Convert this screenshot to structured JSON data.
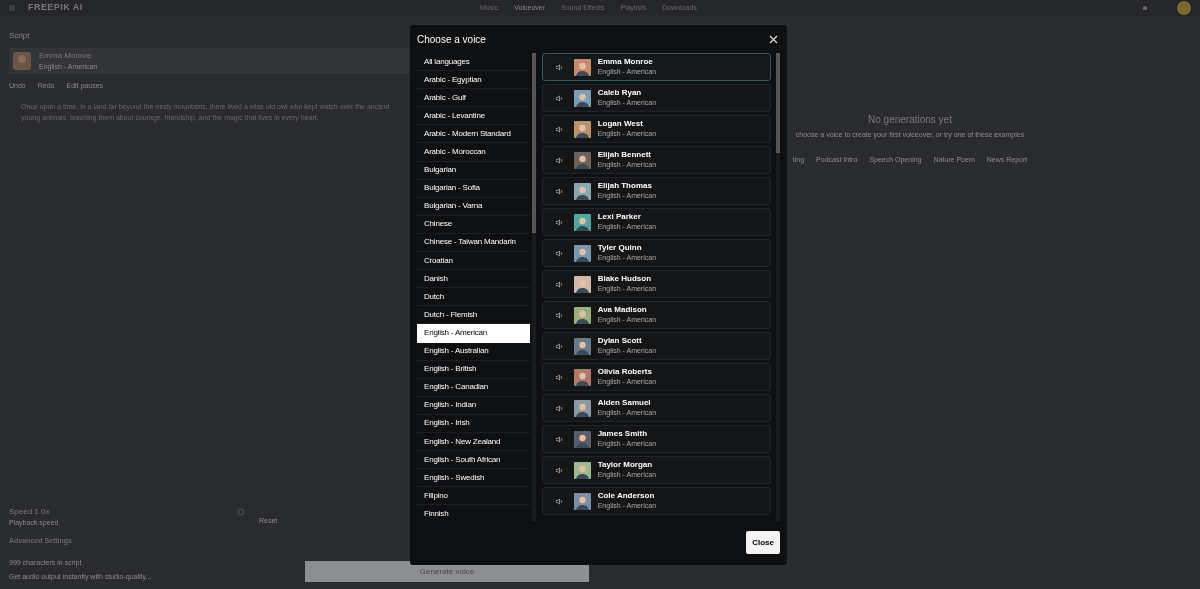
{
  "top_bar": {
    "logo": "FREEPIK AI",
    "nav": [
      {
        "label": "Music",
        "selected": false
      },
      {
        "label": "Voiceover",
        "selected": true
      },
      {
        "label": "Sound Effects",
        "selected": false
      },
      {
        "label": "Playlists",
        "selected": false
      },
      {
        "label": "Downloads",
        "selected": false
      }
    ]
  },
  "editor": {
    "heading": "Script",
    "voice": {
      "name": "Emma Monroe",
      "language": "English - American"
    },
    "tools": [
      "Undo",
      "Redo",
      "Edit pauses"
    ],
    "script_lines": [
      "Once upon a time, in a land far beyond the misty mountains, there lived a wise old owl who kept watch over the ancient",
      "young animals, teaching them about courage, friendship, and the magic that lives in every heart."
    ],
    "speed": {
      "label": "Speed 1.0x",
      "hint": "Playback speed",
      "reset": "Reset"
    },
    "advanced": "Advanced Settings",
    "notes": [
      "999 characters in script",
      "Get audio output instantly with studio-quality..."
    ],
    "generate": "Generate voice"
  },
  "results": {
    "title": "No generations yet",
    "subtitle": "choose a voice to create your first voiceover, or try one of these examples",
    "examples": [
      "ting",
      "Podcast Intro",
      "Speech Opening",
      "Nature Poem",
      "News Report"
    ]
  },
  "modal": {
    "title": "Choose a voice",
    "languages": [
      {
        "label": "All languages",
        "selected": false
      },
      {
        "label": "Arabic - Egyptian",
        "selected": false
      },
      {
        "label": "Arabic - Gulf",
        "selected": false
      },
      {
        "label": "Arabic - Levantine",
        "selected": false
      },
      {
        "label": "Arabic - Modern Standard",
        "selected": false
      },
      {
        "label": "Arabic - Moroccan",
        "selected": false
      },
      {
        "label": "Bulgarian",
        "selected": false
      },
      {
        "label": "Bulgarian - Sofia",
        "selected": false
      },
      {
        "label": "Bulgarian - Varna",
        "selected": false
      },
      {
        "label": "Chinese",
        "selected": false
      },
      {
        "label": "Chinese - Taiwan Mandarin",
        "selected": false
      },
      {
        "label": "Croatian",
        "selected": false
      },
      {
        "label": "Danish",
        "selected": false
      },
      {
        "label": "Dutch",
        "selected": false
      },
      {
        "label": "Dutch - Flemish",
        "selected": false
      },
      {
        "label": "English - American",
        "selected": true
      },
      {
        "label": "English - Australian",
        "selected": false
      },
      {
        "label": "English - British",
        "selected": false
      },
      {
        "label": "English - Canadian",
        "selected": false
      },
      {
        "label": "English - Indian",
        "selected": false
      },
      {
        "label": "English - Irish",
        "selected": false
      },
      {
        "label": "English - New Zealand",
        "selected": false
      },
      {
        "label": "English - South African",
        "selected": false
      },
      {
        "label": "English - Swedish",
        "selected": false
      },
      {
        "label": "Filipino",
        "selected": false
      },
      {
        "label": "Finnish",
        "selected": false
      }
    ],
    "voices": [
      {
        "name": "Emma Monroe",
        "language": "English - American",
        "selected": true
      },
      {
        "name": "Caleb Ryan",
        "language": "English - American",
        "selected": false
      },
      {
        "name": "Logan West",
        "language": "English - American",
        "selected": false
      },
      {
        "name": "Elijah Bennett",
        "language": "English - American",
        "selected": false
      },
      {
        "name": "Elijah Thomas",
        "language": "English - American",
        "selected": false
      },
      {
        "name": "Lexi Parker",
        "language": "English - American",
        "selected": false
      },
      {
        "name": "Tyler Quinn",
        "language": "English - American",
        "selected": false
      },
      {
        "name": "Blake Hudson",
        "language": "English - American",
        "selected": false
      },
      {
        "name": "Ava Madison",
        "language": "English - American",
        "selected": false
      },
      {
        "name": "Dylan Scott",
        "language": "English - American",
        "selected": false
      },
      {
        "name": "Olivia Roberts",
        "language": "English - American",
        "selected": false
      },
      {
        "name": "Aiden Samuel",
        "language": "English - American",
        "selected": false
      },
      {
        "name": "James Smith",
        "language": "English - American",
        "selected": false
      },
      {
        "name": "Taylor Morgan",
        "language": "English - American",
        "selected": false
      },
      {
        "name": "Cole Anderson",
        "language": "English - American",
        "selected": false
      }
    ],
    "close": "Close"
  }
}
